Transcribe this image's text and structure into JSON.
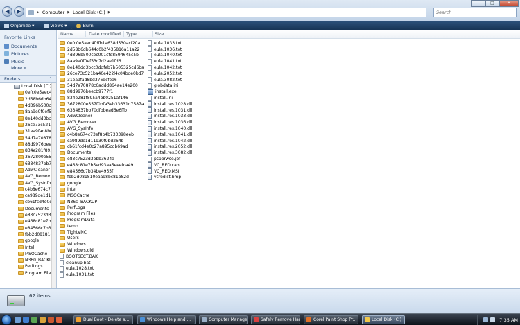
{
  "address_bar": {
    "back_glyph": "◀",
    "forward_glyph": "▶",
    "breadcrumbs": [
      "Computer",
      "Local Disk (C:)"
    ],
    "search_placeholder": "Search"
  },
  "window_controls": {
    "minimize": "–",
    "maximize": "□",
    "close": "✕"
  },
  "toolbar": {
    "organize": "Organize",
    "views": "Views",
    "burn": "Burn",
    "dropdown_glyph": "▾"
  },
  "left_pane": {
    "favorite_links_title": "Favorite Links",
    "favorites": [
      "Documents",
      "Pictures",
      "Music"
    ],
    "more_label": "More",
    "more_glyph": "»",
    "folders_label": "Folders",
    "folders_chevron": "⌃",
    "drive_label": "Local Disk (C:)",
    "tree_items": [
      "0efc0e5aec4f",
      "2d58b6db64",
      "4d396b500c",
      "8aa9e0f0ef53",
      "8e140dd3bc",
      "26ce73c521b",
      "31ea9fad8bd",
      "54d7a70878c",
      "88d9976beec",
      "834e281f895",
      "3672800e557",
      "6334837bb70",
      "AdwCleaner",
      "AVG_Remov",
      "AVG_SysInfo",
      "c4b8e674c73",
      "ca989de1d11",
      "cb61fcd4e0c",
      "Documents",
      "e83c7523d3b",
      "e468c81e7b5",
      "e84566c7b34",
      "fbb2d081810",
      "google",
      "Intel",
      "MSOCache",
      "N360_BACKU",
      "PerfLogs",
      "Program File"
    ]
  },
  "columns": [
    "Name",
    "Date modified",
    "Type",
    "Size"
  ],
  "sort_glyph": "^",
  "files": {
    "column1": [
      {
        "name": "0efc0e5aec4fdfb1a638d530acf20a",
        "kind": "folder"
      },
      {
        "name": "2d58b6db644c0b2f435816a11a22",
        "kind": "folder"
      },
      {
        "name": "4d396b500cec001cfd8594645c5b",
        "kind": "folder"
      },
      {
        "name": "8aa9e0f0ef53c7d2ae1fd6",
        "kind": "folder"
      },
      {
        "name": "8e140dd3bcc0ddfeb7b505325cd6ba",
        "kind": "folder"
      },
      {
        "name": "26ce73c521ba40e422l4c04bde0bd7",
        "kind": "folder"
      },
      {
        "name": "31ea9fad8bd376dcfea6",
        "kind": "folder"
      },
      {
        "name": "54d7a70878c6addd864ae14e200",
        "kind": "folder"
      },
      {
        "name": "88d9976beecb9777f1",
        "kind": "folder"
      },
      {
        "name": "834e281f895a4bb0251af146",
        "kind": "folder"
      },
      {
        "name": "3672800e557f0bfa3eb33631d7587a",
        "kind": "folder"
      },
      {
        "name": "6334837bb70dfbbead6e6ffb",
        "kind": "folder"
      },
      {
        "name": "AdwCleaner",
        "kind": "folder"
      },
      {
        "name": "AVG_Remover",
        "kind": "folder"
      },
      {
        "name": "AVG_SysInfo",
        "kind": "folder"
      },
      {
        "name": "c4b8e674c73ef8b4b733398eeb",
        "kind": "folder"
      },
      {
        "name": "ca989de1d11930f9bd264b",
        "kind": "folder"
      },
      {
        "name": "cb61fcd4e0c27a895cdb69ad",
        "kind": "folder"
      },
      {
        "name": "Documents",
        "kind": "folder"
      },
      {
        "name": "e83c7523d3bbb3624a",
        "kind": "folder"
      },
      {
        "name": "e468c81e7b5ed93aa5eeefca49",
        "kind": "folder"
      },
      {
        "name": "e84566c7b34be4955f",
        "kind": "folder"
      },
      {
        "name": "fbb2d081810eaa98bc81b82d",
        "kind": "folder"
      },
      {
        "name": "google",
        "kind": "folder"
      },
      {
        "name": "Intel",
        "kind": "folder"
      },
      {
        "name": "MSOCache",
        "kind": "folder"
      },
      {
        "name": "N360_BACKUP",
        "kind": "folder"
      },
      {
        "name": "PerfLogs",
        "kind": "folder"
      },
      {
        "name": "Program Files",
        "kind": "folder"
      },
      {
        "name": "ProgramData",
        "kind": "folder"
      },
      {
        "name": "temp",
        "kind": "folder"
      },
      {
        "name": "TightVNC",
        "kind": "folder"
      },
      {
        "name": "Users",
        "kind": "folder"
      },
      {
        "name": "Windows",
        "kind": "folder"
      },
      {
        "name": "Windows.old",
        "kind": "folder"
      },
      {
        "name": "BOOTSECT.BAK",
        "kind": "file"
      },
      {
        "name": "cleanup.bat",
        "kind": "file"
      },
      {
        "name": "eula.1028.txt",
        "kind": "file"
      },
      {
        "name": "eula.1031.txt",
        "kind": "file"
      }
    ],
    "column2": [
      {
        "name": "eula.1033.txt",
        "kind": "file"
      },
      {
        "name": "eula.1036.txt",
        "kind": "file"
      },
      {
        "name": "eula.1040.txt",
        "kind": "file"
      },
      {
        "name": "eula.1041.txt",
        "kind": "file"
      },
      {
        "name": "eula.1042.txt",
        "kind": "file"
      },
      {
        "name": "eula.2052.txt",
        "kind": "file"
      },
      {
        "name": "eula.3082.txt",
        "kind": "file"
      },
      {
        "name": "globdata.ini",
        "kind": "file"
      },
      {
        "name": "install.exe",
        "kind": "exe"
      },
      {
        "name": "install.ini",
        "kind": "file"
      },
      {
        "name": "install.res.1028.dll",
        "kind": "sys"
      },
      {
        "name": "install.res.1031.dll",
        "kind": "sys"
      },
      {
        "name": "install.res.1033.dll",
        "kind": "sys"
      },
      {
        "name": "install.res.1036.dll",
        "kind": "sys"
      },
      {
        "name": "install.res.1040.dll",
        "kind": "sys"
      },
      {
        "name": "install.res.1041.dll",
        "kind": "sys"
      },
      {
        "name": "install.res.1042.dll",
        "kind": "sys"
      },
      {
        "name": "install.res.2052.dll",
        "kind": "sys"
      },
      {
        "name": "install.res.3082.dll",
        "kind": "sys"
      },
      {
        "name": "pspbrwse.jbf",
        "kind": "file"
      },
      {
        "name": "VC_RED.cab",
        "kind": "sys"
      },
      {
        "name": "VC_RED.MSI",
        "kind": "sys"
      },
      {
        "name": "vcredist.bmp",
        "kind": "sys"
      }
    ]
  },
  "status": {
    "item_count": "62 items"
  },
  "taskbar": {
    "buttons": [
      {
        "label": "Dual Boot - Delete a...",
        "color": "#f0a030"
      },
      {
        "label": "Windows Help and ...",
        "color": "#4a8fd6"
      },
      {
        "label": "Computer Manage...",
        "color": "#9bb0c8"
      },
      {
        "label": "Safely Remove Hard...",
        "color": "#d94040"
      },
      {
        "label": "Corel Paint Shop Pr...",
        "color": "#e07028"
      },
      {
        "label": "Local Disk (C:)",
        "color": "#f2c84a"
      }
    ],
    "clock": "7:35 AM"
  }
}
